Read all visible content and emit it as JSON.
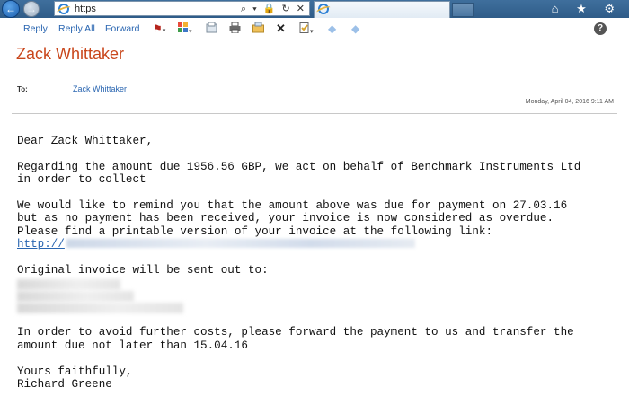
{
  "browser": {
    "address": "https",
    "address_icons": "⌕ ▾ 🔒 ↻ ✕",
    "window_icons": "⌂ ★ ⚙"
  },
  "toolbar": {
    "reply_label": "Reply",
    "reply_all_label": "Reply All",
    "forward_label": "Forward",
    "help_label": "?"
  },
  "header": {
    "sender": "Zack Whittaker",
    "to_label": "To:",
    "to_value": "Zack Whittaker",
    "date": "Monday, April 04, 2016 9:11 AM"
  },
  "body": {
    "greeting": "Dear Zack Whittaker,",
    "p1_line1": "Regarding the amount due 1956.56 GBP, we act on behalf of Benchmark Instruments Ltd",
    "p1_line2": "in order to collect",
    "p2_line1": "We would like to remind you that the amount above was due for payment on 27.03.16",
    "p2_line2": "but as no payment has been received, your invoice is now considered as overdue.",
    "p2_line3": "Please find a printable version of your invoice at the following link:",
    "link_prefix": "http://",
    "p3": "Original invoice will be sent out to:",
    "p4_line1": "In order to avoid further costs, please forward the payment to us and transfer the",
    "p4_line2": "amount due not later than 15.04.16",
    "closing": "Yours faithfully,",
    "signature": "Richard Greene"
  }
}
